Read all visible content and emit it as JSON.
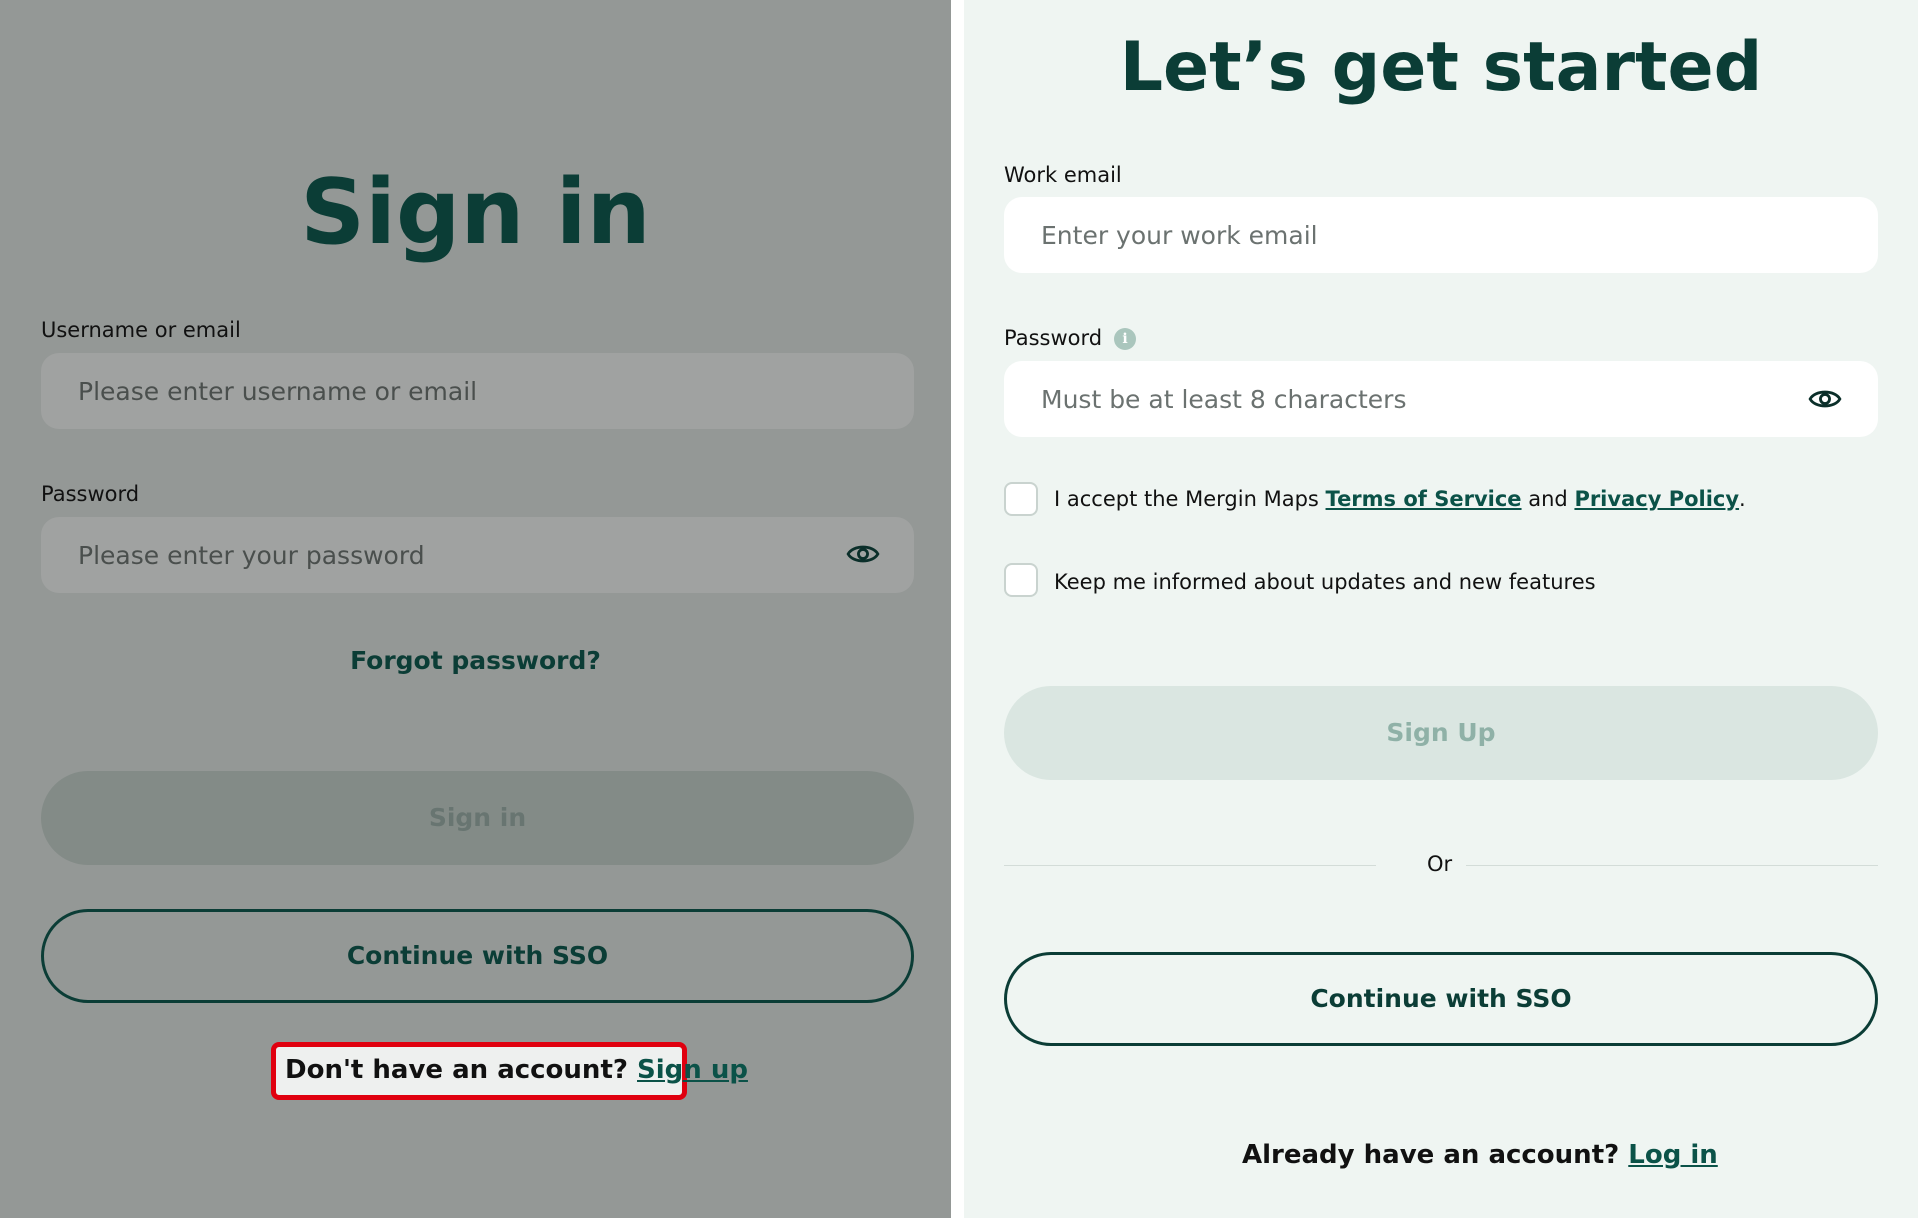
{
  "signin": {
    "title": "Sign in",
    "username_label": "Username or email",
    "username_placeholder": "Please enter username or email",
    "password_label": "Password",
    "password_placeholder": "Please enter your password",
    "forgot_label": "Forgot password?",
    "signin_button": "Sign in",
    "sso_button": "Continue with SSO",
    "no_account_text": "Don't have an account?",
    "signup_link": "Sign up"
  },
  "signup": {
    "title": "Let’s get started",
    "email_label": "Work email",
    "email_placeholder": "Enter your work email",
    "password_label": "Password",
    "password_placeholder": "Must be at least 8 characters",
    "info_icon": "i",
    "terms_prefix": "I accept the Mergin Maps",
    "terms_link": "Terms of Service",
    "terms_and": "and",
    "privacy_link": "Privacy Policy",
    "terms_suffix": ".",
    "keep_informed": "Keep me informed about updates and new features",
    "signup_button": "Sign Up",
    "or_text": "Or",
    "sso_button": "Continue with SSO",
    "have_account_text": "Already have an account?",
    "login_link": "Log in"
  },
  "icons": {
    "eye": "eye-icon",
    "info": "info-icon"
  },
  "colors": {
    "brand": "#0b3d36",
    "highlight": "#e0000f"
  }
}
